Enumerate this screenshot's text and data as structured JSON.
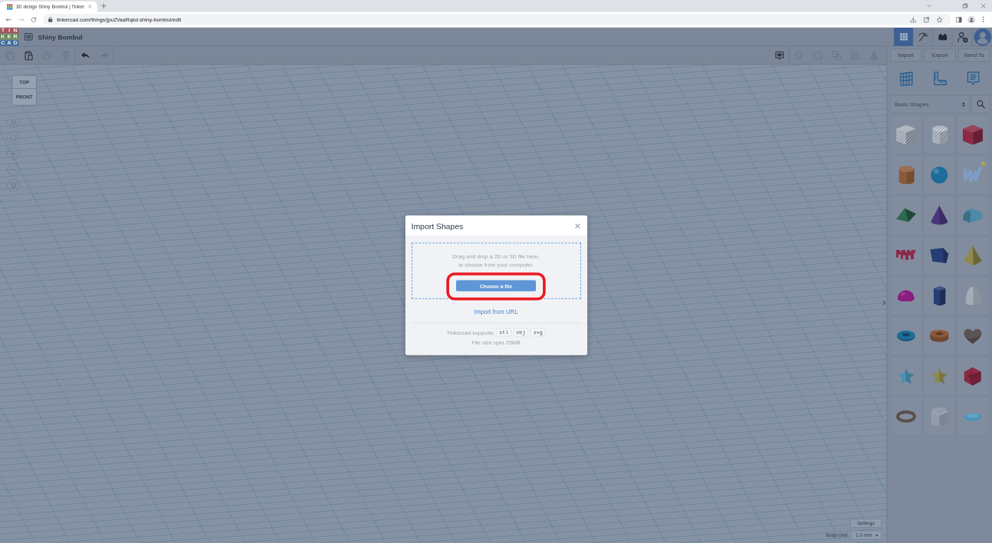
{
  "browser": {
    "tab": {
      "title": "3D design Shiny Bombul | Tinker"
    },
    "url": "tinkercad.com/things/jpu2VaaRqkd-shiny-bombul/edit"
  },
  "header": {
    "logo": [
      {
        "letter": "T",
        "color": "#a4545b"
      },
      {
        "letter": "I",
        "color": "#a4545b"
      },
      {
        "letter": "N",
        "color": "#a4545b"
      },
      {
        "letter": "K",
        "color": "#6b8b56"
      },
      {
        "letter": "E",
        "color": "#6b8b56"
      },
      {
        "letter": "R",
        "color": "#6b8b56"
      },
      {
        "letter": "C",
        "color": "#3f6c9e"
      },
      {
        "letter": "A",
        "color": "#3f6c9e"
      },
      {
        "letter": "D",
        "color": "#3f6c9e"
      }
    ],
    "design_name": "Shiny Bombul",
    "modes": [
      {
        "kind": "grid",
        "selected": true
      },
      {
        "kind": "pickaxe",
        "selected": false
      },
      {
        "kind": "bricks",
        "selected": false
      }
    ]
  },
  "toolbar": {
    "edit_tools": [
      {
        "kind": "copy",
        "disabled": true
      },
      {
        "kind": "paste",
        "disabled": false
      },
      {
        "kind": "duplicate",
        "disabled": true
      },
      {
        "kind": "delete",
        "disabled": true
      }
    ],
    "history_tools": [
      {
        "kind": "undo",
        "disabled": false
      },
      {
        "kind": "redo",
        "disabled": true
      }
    ],
    "view_tools": [
      {
        "kind": "note",
        "disabled": false
      },
      {
        "kind": "light",
        "disabled": true
      },
      {
        "kind": "shape",
        "disabled": true
      },
      {
        "kind": "group",
        "disabled": true
      },
      {
        "kind": "align",
        "disabled": true
      },
      {
        "kind": "mirror",
        "disabled": true
      }
    ]
  },
  "view_cube": {
    "top": "TOP",
    "front": "FRONT"
  },
  "panel": {
    "actions": [
      "Import",
      "Export",
      "Send To"
    ],
    "category": "Basic Shapes",
    "shapes": [
      {
        "kind": "cube",
        "color": "#9aa3b0",
        "hole": true,
        "starred": false
      },
      {
        "kind": "cylinder",
        "color": "#9aa3b0",
        "hole": true,
        "starred": false
      },
      {
        "kind": "cube",
        "color": "#8c2a45",
        "hole": false,
        "starred": false
      },
      {
        "kind": "cylinder",
        "color": "#8b5a3c",
        "hole": false,
        "starred": false
      },
      {
        "kind": "sphere",
        "color": "#1e6c98",
        "hole": false,
        "starred": false
      },
      {
        "kind": "squiggle",
        "color": "#7e9dc6",
        "hole": false,
        "starred": true
      },
      {
        "kind": "wedge",
        "color": "#2d6b4f",
        "hole": false,
        "starred": false
      },
      {
        "kind": "cone",
        "color": "#4b3680",
        "hole": false,
        "starred": false
      },
      {
        "kind": "half-cylinder",
        "color": "#4b8ba8",
        "hole": false,
        "starred": false
      },
      {
        "kind": "letters",
        "color": "#8a2a47",
        "hole": false,
        "starred": false
      },
      {
        "kind": "prism",
        "color": "#253f74",
        "hole": false,
        "starred": false
      },
      {
        "kind": "pyramid",
        "color": "#8f8a4c",
        "hole": false,
        "starred": false
      },
      {
        "kind": "hemisphere",
        "color": "#8a1e7e",
        "hole": false,
        "starred": false
      },
      {
        "kind": "hexagonal-prism",
        "color": "#263f75",
        "hole": false,
        "starred": false
      },
      {
        "kind": "paraboloid",
        "color": "#a3acb8",
        "hole": false,
        "starred": false
      },
      {
        "kind": "torus",
        "color": "#1e6c9a",
        "hole": false,
        "starred": false
      },
      {
        "kind": "tube",
        "color": "#8b5a3c",
        "hole": false,
        "starred": false
      },
      {
        "kind": "heart",
        "color": "#5b5354",
        "hole": false,
        "starred": false
      },
      {
        "kind": "star",
        "color": "#4b8fb0",
        "hole": false,
        "starred": false
      },
      {
        "kind": "star",
        "color": "#8f8a4a",
        "hole": false,
        "starred": false
      },
      {
        "kind": "polyhedron",
        "color": "#8c2a45",
        "hole": false,
        "starred": false
      },
      {
        "kind": "ring",
        "color": "#5a4f4a",
        "hole": false,
        "starred": false
      },
      {
        "kind": "rounded-cube",
        "color": "#929dab",
        "hole": false,
        "starred": false
      },
      {
        "kind": "disc",
        "color": "#4a93b8",
        "hole": false,
        "starred": false
      }
    ]
  },
  "settings": {
    "button": "Settings",
    "snap_label": "Snap Grid",
    "snap_value": "1.0 mm"
  },
  "dialog": {
    "title": "Import Shapes",
    "hint": "Drag and drop a 2D or 3D file here,\nor choose from your computer.",
    "button": "Choose a file",
    "link": "Import from URL",
    "supports_label": "Tinkercad supports",
    "formats": [
      "stl",
      "obj",
      "svg"
    ],
    "size_note": "File size upto 25MB"
  }
}
